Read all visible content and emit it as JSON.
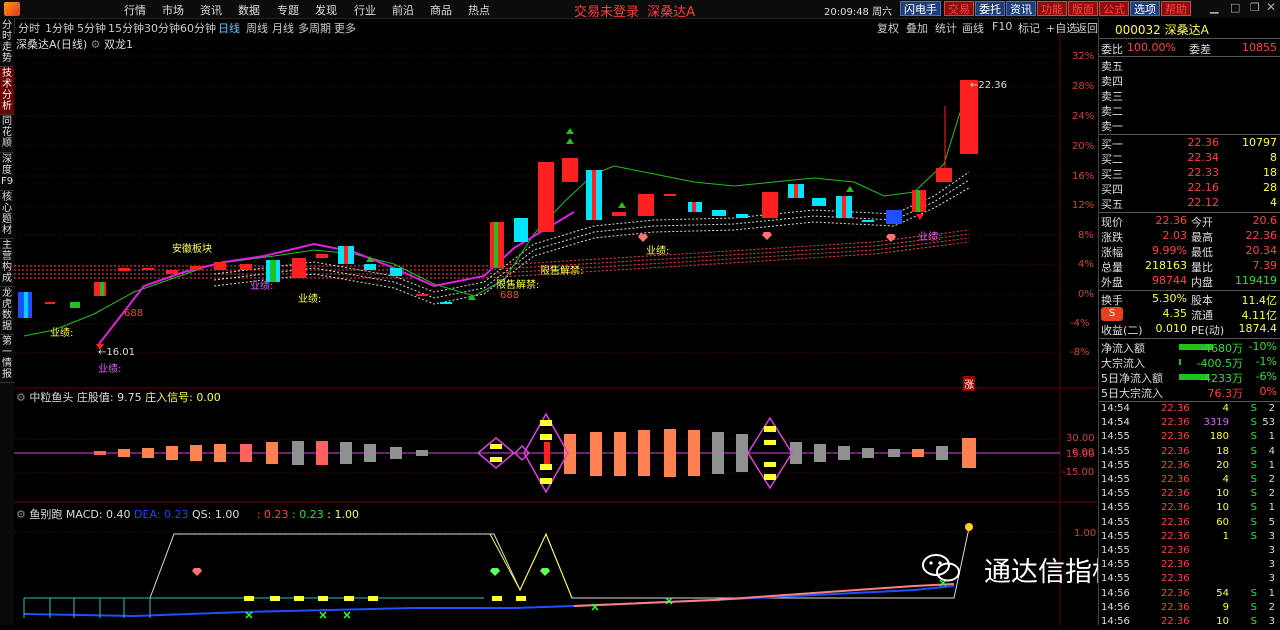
{
  "menu": {
    "items": [
      "行情",
      "市场",
      "资讯",
      "数据",
      "专题",
      "发现",
      "行业",
      "前沿",
      "商品",
      "热点"
    ],
    "login_status": "交易未登录",
    "stock_title": "深桑达A",
    "clock": "20:09:48",
    "weekday": "周六",
    "buttons": [
      "闪电手",
      "交易",
      "委托",
      "资讯",
      "功能",
      "版面",
      "公式",
      "选项",
      "帮助"
    ]
  },
  "periods": {
    "items": [
      "分时",
      "1分钟",
      "5分钟",
      "15分钟",
      "30分钟",
      "60分钟",
      "日线",
      "周线",
      "月线",
      "多周期",
      "更多"
    ],
    "active": "日线",
    "tools": [
      "复权",
      "叠加",
      "统计",
      "画线",
      "F10",
      "标记",
      "+自选",
      "返回"
    ]
  },
  "left_tabs": [
    "分时走势",
    "技术分析",
    "同花顺",
    "深度F9",
    "核心题材",
    "主营构成",
    "龙虎数据",
    "第一情报"
  ],
  "main_panel": {
    "title": "深桑达A(日线)",
    "indicator": "双龙1",
    "y_labels": [
      "32%",
      "28%",
      "24%",
      "20%",
      "16%",
      "12%",
      "8%",
      "4%",
      "0%",
      "-4%",
      "-8%"
    ],
    "annotations": {
      "high_price": "22.36",
      "low_price": "16.01",
      "sector": "安徽板块",
      "yeji": "业绩:",
      "num688": "688",
      "jiejin": "限售解禁:",
      "zhang": "涨"
    }
  },
  "sub1": {
    "name": "中粒鱼头",
    "param1_label": "庄股值:",
    "param1_value": "9.75",
    "param2_label": "庄入信号:",
    "param2_value": "0.00",
    "y_labels": [
      "30.00",
      "15.00",
      "0.00",
      "-15.00"
    ]
  },
  "sub2": {
    "name": "鱼别跑",
    "macd": "MACD: 0.40",
    "dea": "DEA: 0.23",
    "qs": "QS: 1.00",
    "extra": [
      ": 0.23",
      ": 0.23",
      ": 1.00"
    ],
    "y_labels": [
      "1.00"
    ]
  },
  "quote": {
    "code_name": "000032 深桑达A",
    "weibi_label": "委比",
    "weibi_value": "100.00%",
    "weicha_label": "委差",
    "weicha_value": "10855",
    "sell": [
      {
        "label": "卖五",
        "price": "",
        "vol": ""
      },
      {
        "label": "卖四",
        "price": "",
        "vol": ""
      },
      {
        "label": "卖三",
        "price": "",
        "vol": ""
      },
      {
        "label": "卖二",
        "price": "",
        "vol": ""
      },
      {
        "label": "卖一",
        "price": "",
        "vol": ""
      }
    ],
    "buy": [
      {
        "label": "买一",
        "price": "22.36",
        "vol": "10797"
      },
      {
        "label": "买二",
        "price": "22.34",
        "vol": "8"
      },
      {
        "label": "买三",
        "price": "22.33",
        "vol": "18"
      },
      {
        "label": "买四",
        "price": "22.16",
        "vol": "28"
      },
      {
        "label": "买五",
        "price": "22.12",
        "vol": "4"
      }
    ],
    "stats": [
      {
        "l1": "现价",
        "v1": "22.36",
        "l2": "今开",
        "v2": "20.6"
      },
      {
        "l1": "涨跌",
        "v1": "2.03",
        "l2": "最高",
        "v2": "22.36"
      },
      {
        "l1": "涨幅",
        "v1": "9.99%",
        "l2": "最低",
        "v2": "20.34"
      },
      {
        "l1": "总量",
        "v1": "218163",
        "l2": "量比",
        "v2": "7.39"
      },
      {
        "l1": "外盘",
        "v1": "98744",
        "l2": "内盘",
        "v2": "119419"
      },
      {
        "l1": "换手",
        "v1": "5.30%",
        "l2": "股本",
        "v2": "11.4亿"
      },
      {
        "l1": "",
        "v1": "4.35",
        "l2": "流通",
        "v2": "4.11亿"
      },
      {
        "l1": "收益(二)",
        "v1": "0.010",
        "l2": "PE(动)",
        "v2": "1874.4"
      }
    ],
    "flows": [
      {
        "label": "净流入额",
        "value": "-4680万",
        "pct": "-10%"
      },
      {
        "label": "大宗流入",
        "value": "-400.5万",
        "pct": "-1%"
      },
      {
        "label": "5日净流入额",
        "value": "-4233万",
        "pct": "-6%"
      },
      {
        "label": "5日大宗流入",
        "value": "76.3万",
        "pct": "0%"
      }
    ],
    "ticks": [
      {
        "t": "14:54",
        "p": "22.36",
        "v": "4",
        "s": "S",
        "n": "2"
      },
      {
        "t": "14:54",
        "p": "22.36",
        "v": "3319",
        "s": "S",
        "n": "53"
      },
      {
        "t": "14:55",
        "p": "22.36",
        "v": "180",
        "s": "S",
        "n": "1"
      },
      {
        "t": "14:55",
        "p": "22.36",
        "v": "18",
        "s": "S",
        "n": "4"
      },
      {
        "t": "14:55",
        "p": "22.36",
        "v": "20",
        "s": "S",
        "n": "1"
      },
      {
        "t": "14:55",
        "p": "22.36",
        "v": "4",
        "s": "S",
        "n": "2"
      },
      {
        "t": "14:55",
        "p": "22.36",
        "v": "10",
        "s": "S",
        "n": "2"
      },
      {
        "t": "14:55",
        "p": "22.36",
        "v": "10",
        "s": "S",
        "n": "1"
      },
      {
        "t": "14:55",
        "p": "22.36",
        "v": "60",
        "s": "S",
        "n": "5"
      },
      {
        "t": "14:55",
        "p": "22.36",
        "v": "1",
        "s": "S",
        "n": "3"
      },
      {
        "t": "14:55",
        "p": "22.36",
        "v": "",
        "s": "",
        "n": "3"
      },
      {
        "t": "14:55",
        "p": "22.36",
        "v": "",
        "s": "",
        "n": "3"
      },
      {
        "t": "14:55",
        "p": "22.36",
        "v": "",
        "s": "",
        "n": "3"
      },
      {
        "t": "14:56",
        "p": "22.36",
        "v": "54",
        "s": "S",
        "n": "1"
      },
      {
        "t": "14:56",
        "p": "22.36",
        "v": "9",
        "s": "S",
        "n": "2"
      },
      {
        "t": "14:56",
        "p": "22.36",
        "v": "10",
        "s": "S",
        "n": "3"
      }
    ]
  },
  "watermark": "通达信指标爱好者",
  "colors": {
    "up": "#ff2020",
    "down": "#00e5ff",
    "bg": "#000000",
    "grid": "#5a0000"
  }
}
